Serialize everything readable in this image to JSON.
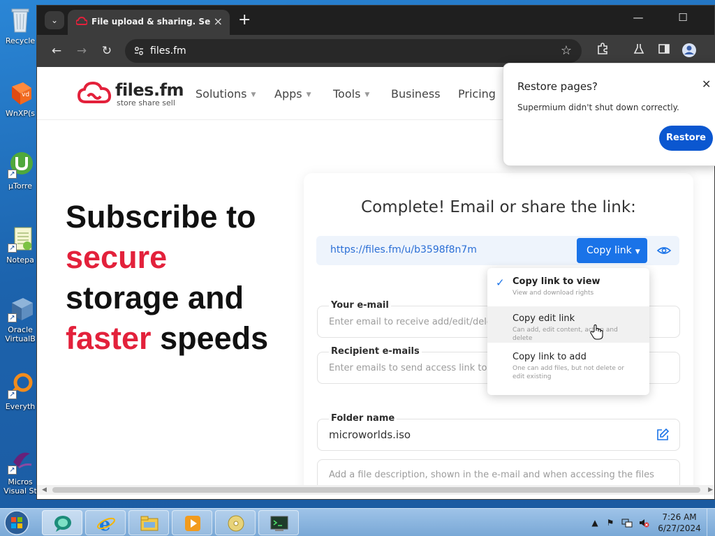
{
  "desktop": {
    "icons": [
      {
        "label": "Recycle",
        "icon": "recycle-bin-icon"
      },
      {
        "label": "WnXP(s",
        "icon": "virtualbox-cube-icon"
      },
      {
        "label": "µTorre",
        "icon": "utorrent-icon"
      },
      {
        "label": "Notepa",
        "icon": "notepad-icon"
      },
      {
        "label": "Oracle VirtualB",
        "icon": "virtualbox-icon"
      },
      {
        "label": "Everyth",
        "icon": "everything-search-icon"
      },
      {
        "label": "Micros Visual St",
        "icon": "visual-studio-icon"
      }
    ]
  },
  "browser": {
    "tab_title": "File upload & sharing. Send la",
    "url": "files.fm",
    "window_controls": {
      "minimize": "—",
      "maximize": "☐",
      "close": "✕"
    }
  },
  "site": {
    "logo_name": "files.fm",
    "logo_tagline": "store share sell",
    "nav": [
      "Solutions",
      "Apps",
      "Tools",
      "Business",
      "Pricing"
    ],
    "nav_has_caret": [
      true,
      true,
      true,
      false,
      false
    ],
    "hero": {
      "line1": "Subscribe to",
      "line2": "secure",
      "line3": "storage and",
      "line4_accent": "faster",
      "line4_rest": " speeds"
    },
    "brand_color": "#e3213b"
  },
  "share_card": {
    "heading": "Complete! Email or share the link:",
    "link": "https://files.fm/u/b3598f8n7m",
    "copy_button": "Copy link",
    "email_label": "Your e-mail",
    "email_placeholder": "Enter email to receive add/edit/delete",
    "recipients_label": "Recipient e-mails",
    "recipients_placeholder": "Enter emails to send access link to",
    "folder_label": "Folder name",
    "folder_value": "microworlds.iso",
    "description_placeholder": "Add a file description, shown in the e-mail and when accessing the files"
  },
  "copy_menu": [
    {
      "title": "Copy link to view",
      "desc": "View and download rights",
      "checked": true
    },
    {
      "title": "Copy edit link",
      "desc": "Can add, edit content, action and delete",
      "checked": false
    },
    {
      "title": "Copy link to add",
      "desc": "One can add files, but not delete or edit existing",
      "checked": false
    }
  ],
  "restore_bubble": {
    "title": "Restore pages?",
    "message": "Supermium didn't shut down correctly.",
    "button": "Restore"
  },
  "taskbar": {
    "pinned": [
      "chat-app-icon",
      "internet-explorer-icon",
      "file-explorer-icon",
      "media-player-icon",
      "cd-disc-icon",
      "terminal-app-icon"
    ],
    "clock_time": "7:26 AM",
    "clock_date": "6/27/2024"
  }
}
